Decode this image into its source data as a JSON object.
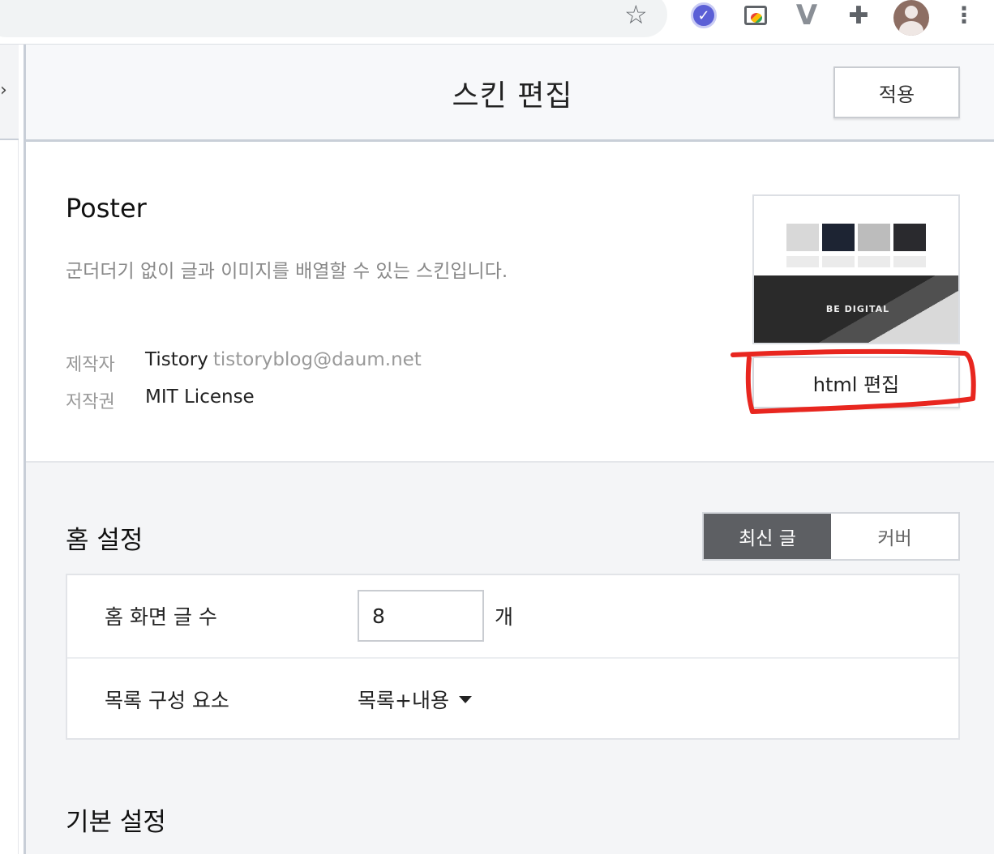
{
  "browser": {
    "icons": [
      "star-icon",
      "check-extension-icon",
      "cast-extension-icon",
      "v-extension-icon",
      "puzzle-icon",
      "avatar",
      "more-vert-icon"
    ]
  },
  "editor": {
    "title": "스킨 편집",
    "apply_label": "적용"
  },
  "skin": {
    "name": "Poster",
    "description": "군더더기 없이 글과 이미지를 배열할 수 있는 스킨입니다.",
    "author_label": "제작자",
    "author_name": "Tistory",
    "author_email": "tistoryblog@daum.net",
    "license_label": "저작권",
    "license_value": "MIT License",
    "thumbnail_banner_text": "BE DIGITAL",
    "html_edit_label": "html 편집"
  },
  "home_settings": {
    "title": "홈 설정",
    "toggle": {
      "options": [
        "최신 글",
        "커버"
      ],
      "selected": "최신 글"
    },
    "post_count_label": "홈 화면 글 수",
    "post_count_value": "8",
    "post_count_unit": "개",
    "list_components_label": "목록 구성 요소",
    "list_components_value": "목록+내용"
  },
  "basic_settings": {
    "title": "기본 설정"
  },
  "colors": {
    "annotation": "#e8261f",
    "toggle_active": "#5d5f63",
    "header_bg": "#f7f8fa",
    "section_bg": "#f4f5f7"
  }
}
